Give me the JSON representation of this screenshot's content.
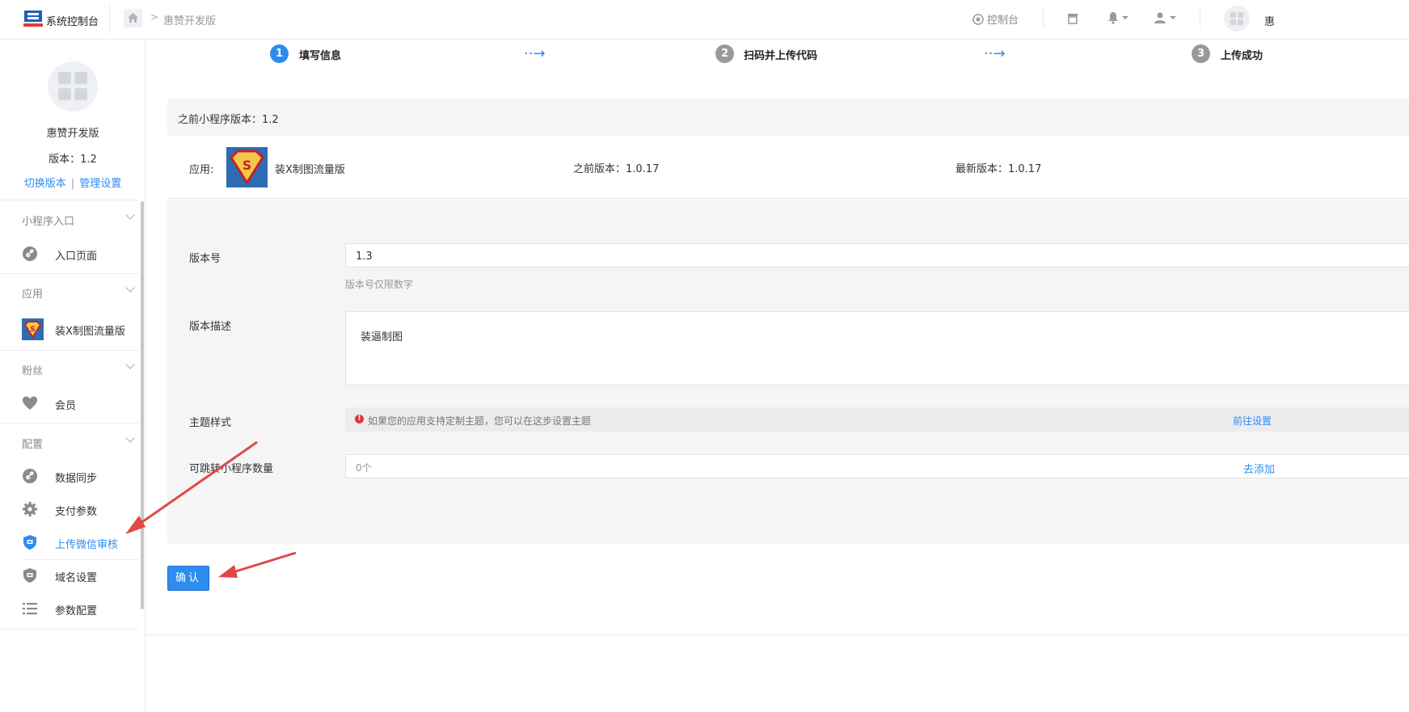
{
  "header": {
    "logo_text": "系统控制台",
    "breadcrumb": "惠赞开发版",
    "console_label": "控制台",
    "right_edge_char": "惠"
  },
  "sidebar": {
    "app_name": "惠赞开发版",
    "version": "版本：1.2",
    "switch_version": "切换版本",
    "link_sep": "|",
    "manage_settings": "管理设置",
    "sections": {
      "entry": "小程序入口",
      "apps": "应用",
      "fans": "粉丝",
      "config": "配置"
    },
    "items": {
      "entry_page": "入口页面",
      "app_item": "装X制图流量版",
      "member": "会员",
      "data_sync": "数据同步",
      "pay_params": "支付参数",
      "upload_wechat_review": "上传微信审核",
      "domain_settings": "域名设置",
      "param_config": "参数配置"
    }
  },
  "steps": [
    {
      "num": "1",
      "label": "填写信息",
      "active": true
    },
    {
      "num": "2",
      "label": "扫码并上传代码",
      "active": false
    },
    {
      "num": "3",
      "label": "上传成功",
      "active": false
    }
  ],
  "content": {
    "previous_miniprogram_version": "之前小程序版本：1.2",
    "app_label": "应用:",
    "app_name": "装X制图流量版",
    "previous_version": "之前版本：1.0.17",
    "latest_version": "最新版本：1.0.17"
  },
  "form": {
    "version_label": "版本号",
    "version_value": "1.3",
    "version_hint": "版本号仅限数字",
    "desc_label": "版本描述",
    "desc_value": "装逼制图",
    "theme_label": "主题样式",
    "theme_notice": "如果您的应用支持定制主题，您可以在这步设置主题",
    "theme_link": "前往设置",
    "jump_label": "可跳转小程序数量",
    "jump_value": "0个",
    "jump_link": "去添加",
    "confirm": "确认"
  },
  "colors": {
    "accent": "#2d8cf0",
    "step_inactive": "#999999",
    "annotation_arrow": "#e04848"
  }
}
